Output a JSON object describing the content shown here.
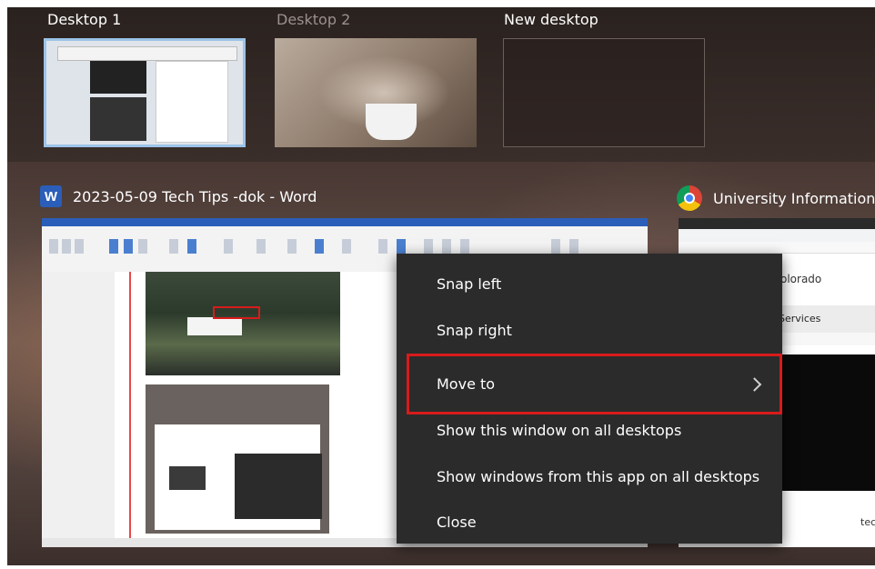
{
  "desktops": [
    {
      "label": "Desktop 1",
      "active": true
    },
    {
      "label": "Desktop 2",
      "active": false
    },
    {
      "label": "New desktop",
      "active": false
    }
  ],
  "windows": {
    "word": {
      "title": "2023-05-09 Tech Tips -dok - Word",
      "icon": "word-icon"
    },
    "chrome": {
      "title": "University Information",
      "icon": "chrome-icon",
      "page_logo": "olorado",
      "page_heading": "Services",
      "page_fragment": "tec"
    }
  },
  "context_menu": {
    "items": [
      {
        "label": "Snap left"
      },
      {
        "label": "Snap right"
      },
      {
        "label": "Move to",
        "submenu": true,
        "highlighted": true
      },
      {
        "label": "Show this window on all desktops"
      },
      {
        "label": "Show windows from this app on all desktops"
      },
      {
        "label": "Close"
      }
    ]
  },
  "colors": {
    "highlight_border": "#d81b1b",
    "menu_bg": "#2b2b2b",
    "active_desktop_border": "#9cc3e8"
  }
}
